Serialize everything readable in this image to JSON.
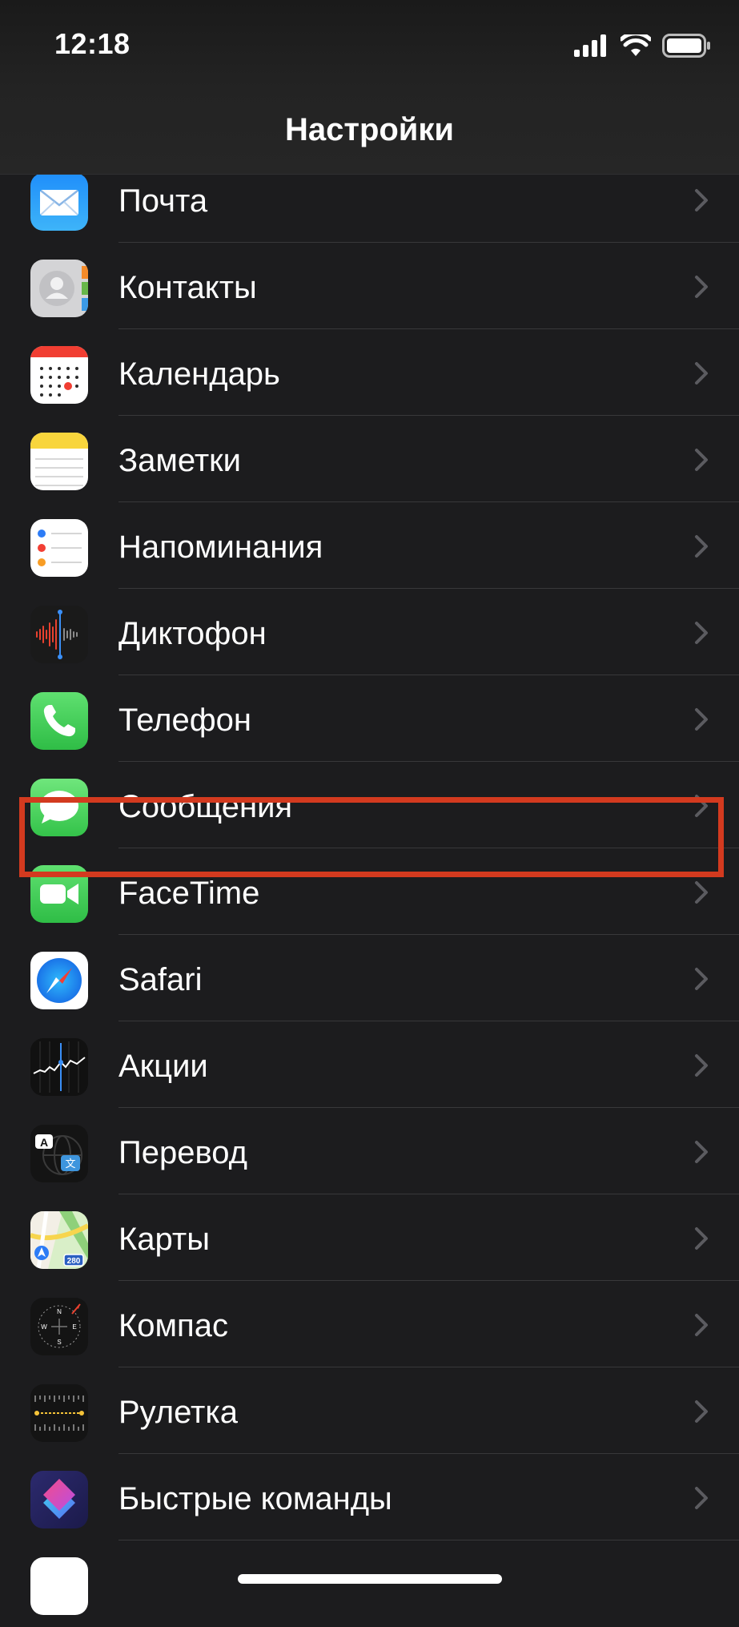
{
  "status_bar": {
    "time": "12:18",
    "icons": [
      "cellular-signal-icon",
      "wifi-icon",
      "battery-icon"
    ]
  },
  "nav": {
    "title": "Настройки"
  },
  "highlight_color": "#d33a1f",
  "rows": [
    {
      "label": "Почта",
      "icon": "mail-icon"
    },
    {
      "label": "Контакты",
      "icon": "contacts-icon"
    },
    {
      "label": "Календарь",
      "icon": "calendar-icon"
    },
    {
      "label": "Заметки",
      "icon": "notes-icon"
    },
    {
      "label": "Напоминания",
      "icon": "reminders-icon"
    },
    {
      "label": "Диктофон",
      "icon": "voice-memos-icon"
    },
    {
      "label": "Телефон",
      "icon": "phone-icon"
    },
    {
      "label": "Сообщения",
      "icon": "messages-icon",
      "highlighted": true
    },
    {
      "label": "FaceTime",
      "icon": "facetime-icon"
    },
    {
      "label": "Safari",
      "icon": "safari-icon"
    },
    {
      "label": "Акции",
      "icon": "stocks-icon"
    },
    {
      "label": "Перевод",
      "icon": "translate-icon"
    },
    {
      "label": "Карты",
      "icon": "maps-icon"
    },
    {
      "label": "Компас",
      "icon": "compass-icon"
    },
    {
      "label": "Рулетка",
      "icon": "measure-icon"
    },
    {
      "label": "Быстрые команды",
      "icon": "shortcuts-icon"
    }
  ]
}
